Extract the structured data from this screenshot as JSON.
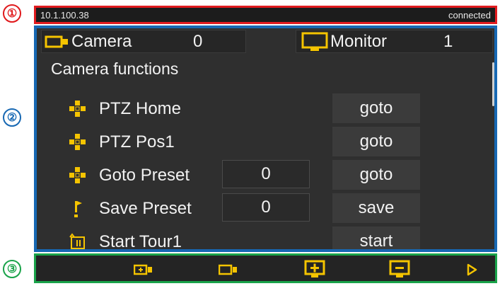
{
  "callouts": {
    "one": "①",
    "two": "②",
    "three": "③"
  },
  "statusbar": {
    "ip": "10.1.100.38",
    "state": "connected"
  },
  "header": {
    "camera_label": "Camera",
    "camera_value": "0",
    "monitor_label": "Monitor",
    "monitor_value": "1"
  },
  "section": {
    "title": "Camera functions"
  },
  "rows": [
    {
      "label": "PTZ Home",
      "action": "goto",
      "icon": "ptz-home-icon"
    },
    {
      "label": "PTZ Pos1",
      "action": "goto",
      "icon": "ptz-pos1-icon"
    },
    {
      "label": "Goto Preset",
      "value": "0",
      "action": "goto",
      "icon": "ptz-preset-icon"
    },
    {
      "label": "Save Preset",
      "value": "0",
      "action": "save",
      "icon": "flag-icon"
    },
    {
      "label": "Start Tour1",
      "action": "start",
      "icon": "tour-icon"
    }
  ],
  "toolbar": {
    "items": [
      "camera-plus-icon",
      "camera-icon",
      "monitor-plus-icon",
      "monitor-minus-icon",
      "play-icon"
    ]
  },
  "colors": {
    "accent_yellow": "#f5c400",
    "status_border": "#e11b1f",
    "main_border": "#1768b3",
    "toolbar_border": "#1aa34a"
  }
}
